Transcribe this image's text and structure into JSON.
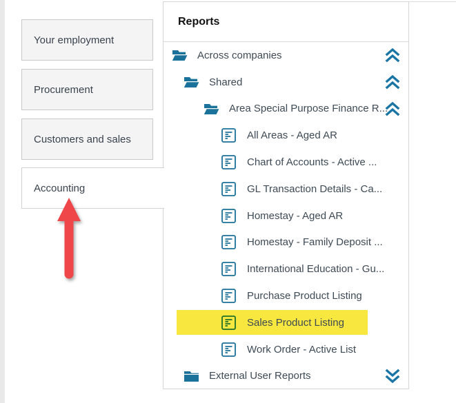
{
  "sidebar": {
    "tabs": [
      {
        "label": "Your employment",
        "active": false
      },
      {
        "label": "Procurement",
        "active": false
      },
      {
        "label": "Customers and sales",
        "active": false
      },
      {
        "label": "Accounting",
        "active": true
      }
    ]
  },
  "panel": {
    "title": "Reports",
    "tree": [
      {
        "label": "Across companies",
        "type": "folder-open",
        "level": 0,
        "chevron": "collapse-up"
      },
      {
        "label": "Shared",
        "type": "folder-open",
        "level": 1,
        "chevron": "collapse-up"
      },
      {
        "label": "Area Special Purpose Finance R...",
        "type": "folder-open",
        "level": 2,
        "chevron": "collapse-up"
      },
      {
        "label": "All Areas - Aged AR",
        "type": "report",
        "level": 3
      },
      {
        "label": "Chart of Accounts - Active ...",
        "type": "report",
        "level": 3
      },
      {
        "label": "GL Transaction Details - Ca...",
        "type": "report",
        "level": 3
      },
      {
        "label": "Homestay - Aged AR",
        "type": "report",
        "level": 3
      },
      {
        "label": "Homestay - Family Deposit ...",
        "type": "report",
        "level": 3
      },
      {
        "label": "International Education - Gu...",
        "type": "report",
        "level": 3
      },
      {
        "label": "Purchase Product Listing",
        "type": "report",
        "level": 3
      },
      {
        "label": "Sales Product Listing",
        "type": "report",
        "level": 3,
        "highlighted": true
      },
      {
        "label": "Work Order - Active List",
        "type": "report",
        "level": 3
      },
      {
        "label": "External User Reports",
        "type": "folder-closed",
        "level": 1,
        "chevron": "expand-down"
      }
    ]
  },
  "annotations": {
    "highlighted_item": "Sales Product Listing",
    "arrow_points_to": "Accounting"
  },
  "colors": {
    "icon_blue": "#1a7199",
    "highlight_yellow": "#f8e73e",
    "highlight_icon_green": "#1e7029",
    "arrow_red": "#ee4649",
    "button_gray": "#f4f4f4",
    "border_gray": "#d5d5d5"
  }
}
